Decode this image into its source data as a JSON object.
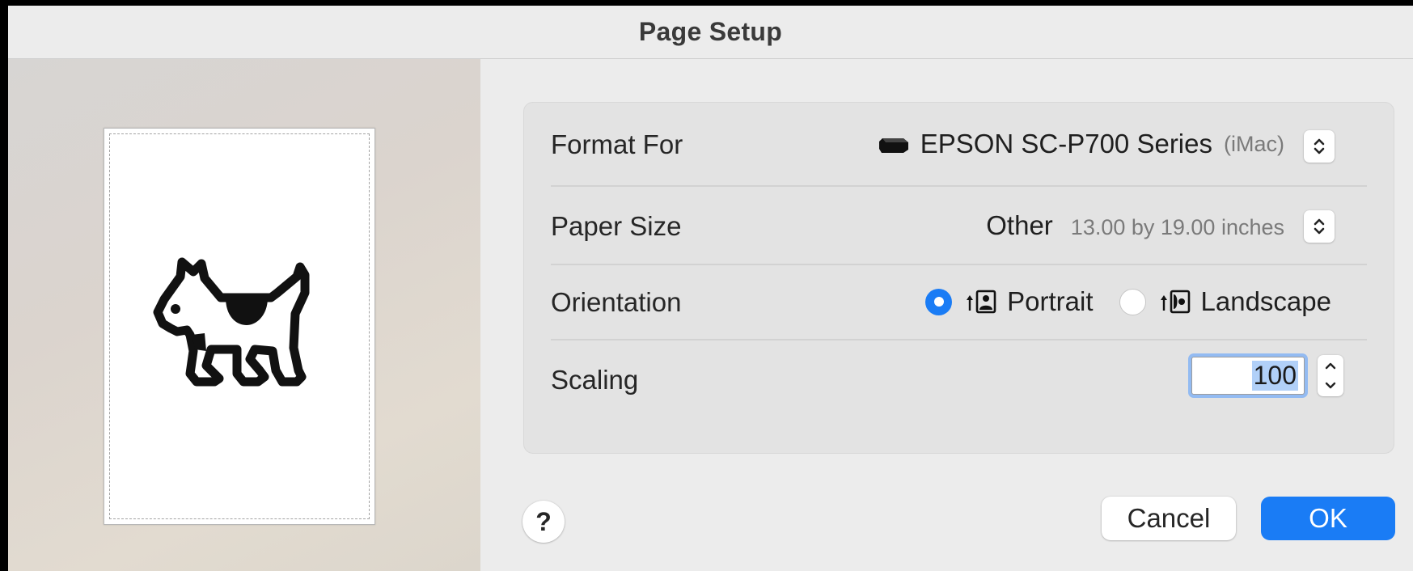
{
  "window": {
    "title": "Page Setup"
  },
  "form": {
    "format_for": {
      "label": "Format For",
      "printer_name": "EPSON SC-P700 Series",
      "printer_host": "(iMac)",
      "icon": "printer-icon"
    },
    "paper_size": {
      "label": "Paper Size",
      "name": "Other",
      "dimensions": "13.00 by 19.00 inches"
    },
    "orientation": {
      "label": "Orientation",
      "selected": "Portrait",
      "options": [
        {
          "label": "Portrait",
          "icon": "portrait-orientation-icon",
          "checked": true
        },
        {
          "label": "Landscape",
          "icon": "landscape-orientation-icon",
          "checked": false
        }
      ]
    },
    "scaling": {
      "label": "Scaling",
      "value": "100"
    }
  },
  "buttons": {
    "help": "?",
    "cancel": "Cancel",
    "ok": "OK"
  },
  "colors": {
    "accent": "#1a7cf5",
    "selection": "#b1d0f8",
    "focus_ring": "#93bbf2"
  }
}
